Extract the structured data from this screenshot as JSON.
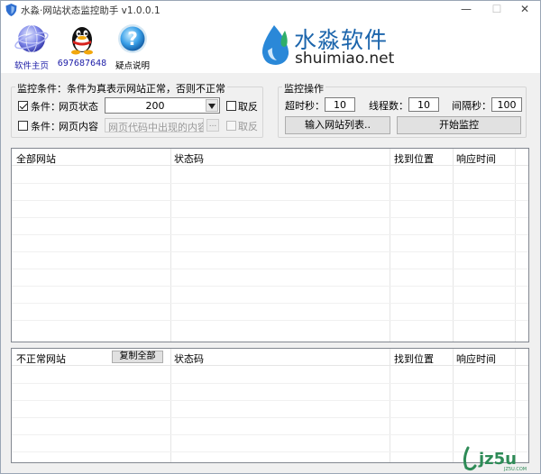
{
  "window": {
    "title": "水淼·网站状态监控助手 v1.0.0.1",
    "controls": {
      "minimize": "—",
      "maximize": "☐",
      "close": "✕"
    }
  },
  "toolbar": {
    "items": [
      {
        "label": "软件主页",
        "icon": "globe-icon",
        "color": "#1a1aa6"
      },
      {
        "label": "697687648",
        "icon": "qq-penguin-icon",
        "color": "#1a1aa6"
      },
      {
        "label": "疑点说明",
        "icon": "help-icon",
        "color": "#000000"
      }
    ]
  },
  "brand": {
    "cn": "水淼软件",
    "en": "shuimiao.net",
    "color": "#1c65ac"
  },
  "monitor_conditions": {
    "legend": "监控条件：条件为真表示网站正常，否则不正常",
    "row1": {
      "checked": true,
      "prefix": "条件：",
      "field_label": "网页状态",
      "select_value": "200",
      "negate_label": "取反",
      "negate_checked": false
    },
    "row2": {
      "checked": false,
      "prefix": "条件：",
      "field_label": "网页内容",
      "placeholder": "网页代码中出现的内容",
      "browse_label": "...",
      "negate_label": "取反",
      "negate_checked": false
    }
  },
  "monitor_ops": {
    "legend": "监控操作",
    "timeout_label": "超时秒：",
    "timeout_value": "10",
    "threads_label": "线程数：",
    "threads_value": "10",
    "interval_label": "间隔秒：",
    "interval_value": "100",
    "import_button": "输入网站列表..",
    "start_button": "开始监控"
  },
  "all_sites_table": {
    "columns": [
      "全部网站",
      "状态码",
      "找到位置",
      "响应时间"
    ]
  },
  "abnormal_sites_table": {
    "columns": [
      "不正常网站",
      "状态码",
      "找到位置",
      "响应时间"
    ],
    "copy_all_button": "复制全部"
  },
  "watermark": {
    "text": "jz5u",
    "sub": "JZ5U.COM",
    "color": "#2e8b57"
  }
}
